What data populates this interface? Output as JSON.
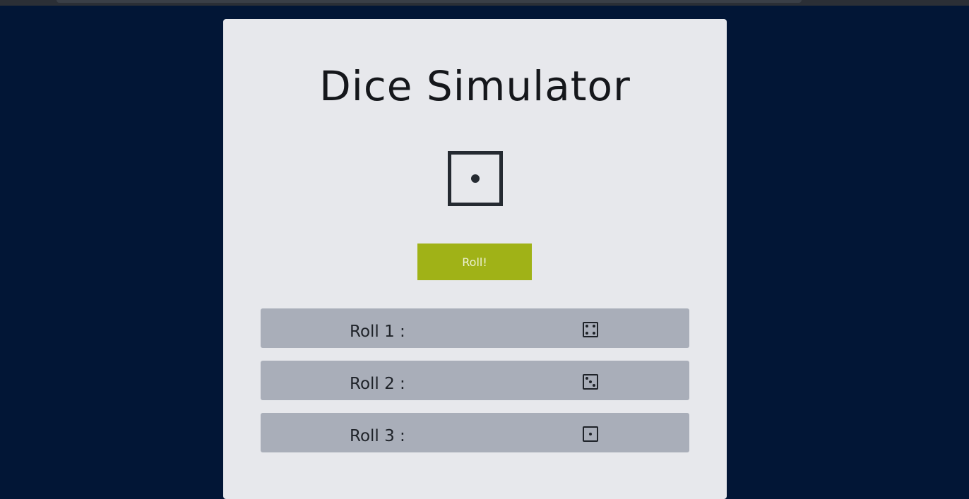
{
  "app": {
    "title": "Dice Simulator"
  },
  "current_die": {
    "icon": "die-face-one-icon",
    "value": 1
  },
  "roll_button": {
    "label": "Roll!",
    "color": "#a0b217"
  },
  "history": [
    {
      "label": "Roll 1 :",
      "icon": "die-face-four-icon",
      "value": 4
    },
    {
      "label": "Roll 2 :",
      "icon": "die-face-three-icon",
      "value": 3
    },
    {
      "label": "Roll 3 :",
      "icon": "die-face-one-icon",
      "value": 1
    }
  ],
  "colors": {
    "background": "#021636",
    "card": "#e7e8ec",
    "history_row": "#a9aeb9",
    "ink": "#252a31"
  }
}
